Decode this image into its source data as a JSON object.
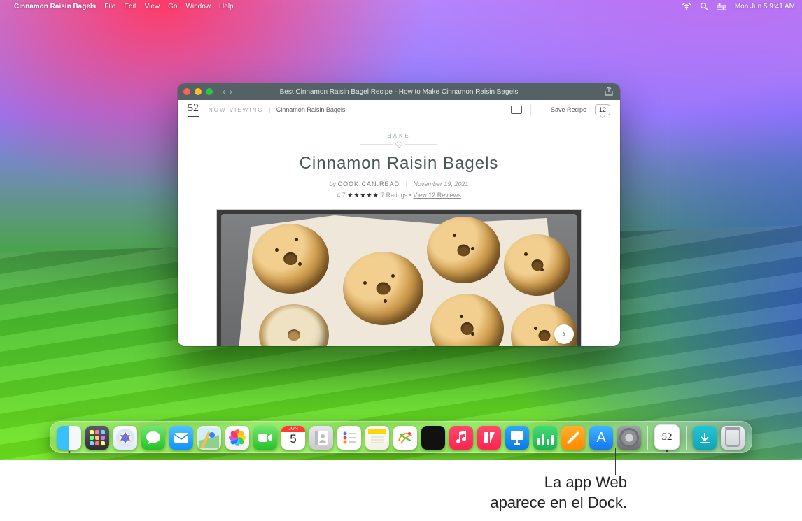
{
  "menubar": {
    "app_name": "Cinnamon Raisin Bagels",
    "items": [
      "File",
      "Edit",
      "View",
      "Go",
      "Window",
      "Help"
    ],
    "clock": "Mon Jun 5  9:41 AM"
  },
  "window": {
    "title": "Best Cinnamon Raisin Bagel Recipe - How to Make Cinnamon Raisin Bagels",
    "brand": "52",
    "now_viewing_label": "NOW VIEWING",
    "breadcrumb": "Cinnamon Raisin Bagels",
    "save_recipe_label": "Save Recipe",
    "comment_count": "12",
    "category": "BAKE",
    "heading": "Cinnamon Raisin Bagels",
    "by_label": "by",
    "author": "COOK.CAN.READ",
    "date": "November 19, 2021",
    "rating_value": "4.7",
    "rating_stars": "★★★★★",
    "ratings_count_label": "7 Ratings",
    "reviews_link": "View 12 Reviews"
  },
  "dock": {
    "calendar_month": "JUN",
    "calendar_day": "5",
    "webapp_label": "52",
    "items": [
      {
        "name": "finder",
        "label": "Finder"
      },
      {
        "name": "launchpad",
        "label": "Launchpad"
      },
      {
        "name": "safari",
        "label": "Safari"
      },
      {
        "name": "messages",
        "label": "Messages"
      },
      {
        "name": "mail",
        "label": "Mail"
      },
      {
        "name": "maps",
        "label": "Maps"
      },
      {
        "name": "photos",
        "label": "Photos"
      },
      {
        "name": "facetime",
        "label": "FaceTime"
      },
      {
        "name": "calendar",
        "label": "Calendar"
      },
      {
        "name": "contacts",
        "label": "Contacts"
      },
      {
        "name": "reminders",
        "label": "Reminders"
      },
      {
        "name": "notes",
        "label": "Notes"
      },
      {
        "name": "freeform",
        "label": "Freeform"
      },
      {
        "name": "tv",
        "label": "TV"
      },
      {
        "name": "music",
        "label": "Music"
      },
      {
        "name": "news",
        "label": "News"
      },
      {
        "name": "keynote",
        "label": "Keynote"
      },
      {
        "name": "numbers",
        "label": "Numbers"
      },
      {
        "name": "pages",
        "label": "Pages"
      },
      {
        "name": "appstore",
        "label": "App Store"
      },
      {
        "name": "settings",
        "label": "System Settings"
      }
    ]
  },
  "caption": {
    "line1": "La app Web",
    "line2": "aparece en el Dock."
  }
}
